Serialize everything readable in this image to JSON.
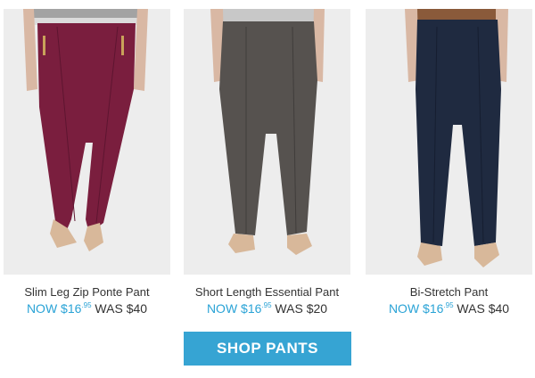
{
  "products": [
    {
      "name": "Slim Leg Zip Ponte Pant",
      "now_label": "NOW",
      "now_dollars": "$16",
      "now_cents": ".95",
      "was_label": "WAS",
      "was_price": "$40",
      "pant_color": "#7a1e3e"
    },
    {
      "name": "Short Length Essential Pant",
      "now_label": "NOW",
      "now_dollars": "$16",
      "now_cents": ".95",
      "was_label": "WAS",
      "was_price": "$20",
      "pant_color": "#56524f"
    },
    {
      "name": "Bi-Stretch Pant",
      "now_label": "NOW",
      "now_dollars": "$16",
      "now_cents": ".95",
      "was_label": "WAS",
      "was_price": "$40",
      "pant_color": "#1f2a40"
    }
  ],
  "cta": {
    "label": "SHOP PANTS"
  },
  "colors": {
    "accent": "#2aa3d6",
    "button": "#36a4d3"
  }
}
